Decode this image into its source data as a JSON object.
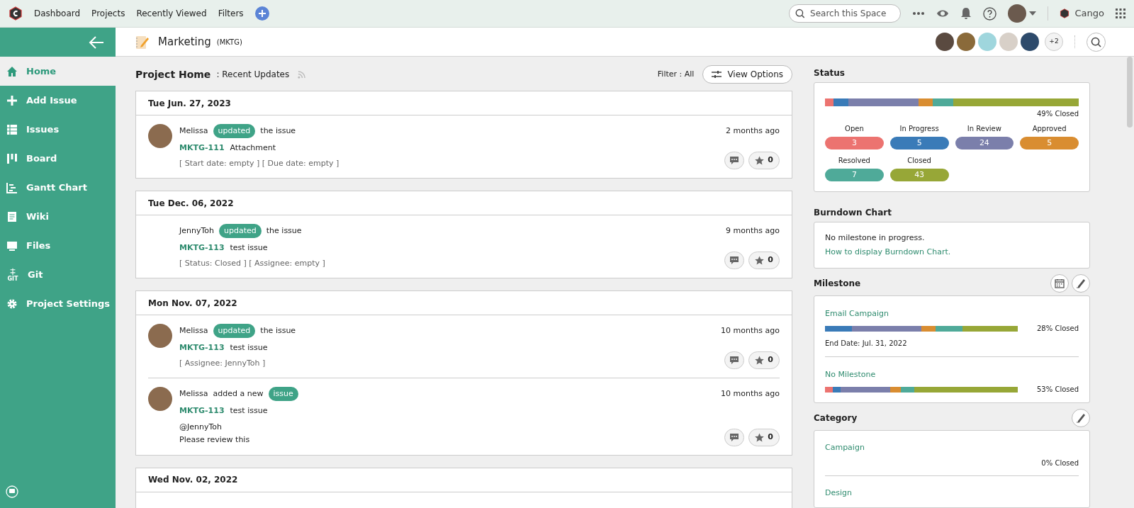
{
  "top_nav": {
    "items": [
      "Dashboard",
      "Projects",
      "Recently Viewed",
      "Filters"
    ],
    "search_placeholder": "Search this Space",
    "org": "Cango"
  },
  "project": {
    "name": "Marketing",
    "key": "(MKTG)",
    "members_more": "+2"
  },
  "sidebar": {
    "items": [
      {
        "label": "Home",
        "selected": true
      },
      {
        "label": "Add Issue",
        "selected": false
      },
      {
        "label": "Issues",
        "selected": false
      },
      {
        "label": "Board",
        "selected": false
      },
      {
        "label": "Gantt Chart",
        "selected": false
      },
      {
        "label": "Wiki",
        "selected": false
      },
      {
        "label": "Files",
        "selected": false
      },
      {
        "label": "Git",
        "icon_caption": "GIT",
        "selected": false
      },
      {
        "label": "Project Settings",
        "selected": false
      }
    ]
  },
  "feed": {
    "title": "Project Home",
    "subtitle": ": Recent Updates",
    "filter": "Filter : All",
    "view_options": "View Options",
    "groups": [
      {
        "date": "Tue Jun. 27, 2023",
        "entries": [
          {
            "avatar": true,
            "user": "Melissa",
            "badge": "updated",
            "after": "the issue",
            "issue_key": "MKTG-111",
            "issue_title": "Attachment",
            "details": [
              "[ Start date: empty ] [ Due date: empty ]"
            ],
            "time": "2 months ago",
            "stars": "0"
          }
        ]
      },
      {
        "date": "Tue Dec. 06, 2022",
        "entries": [
          {
            "avatar": false,
            "user": "JennyToh",
            "badge": "updated",
            "after": "the issue",
            "issue_key": "MKTG-113",
            "issue_title": "test issue",
            "details": [
              "[ Status: Closed ] [ Assignee: empty ]"
            ],
            "time": "9 months ago",
            "stars": "0"
          }
        ]
      },
      {
        "date": "Mon Nov. 07, 2022",
        "entries": [
          {
            "avatar": true,
            "user": "Melissa",
            "badge": "updated",
            "after": "the issue",
            "issue_key": "MKTG-113",
            "issue_title": "test issue",
            "details": [
              "[ Assignee: JennyToh ]"
            ],
            "time": "10 months ago",
            "stars": "0"
          },
          {
            "avatar": true,
            "user": "Melissa",
            "before": "added a new",
            "badge": "issue",
            "issue_key": "MKTG-113",
            "issue_title": "test issue",
            "comment": [
              "@JennyToh",
              "Please review this"
            ],
            "time": "10 months ago",
            "stars": "0"
          }
        ]
      },
      {
        "date": "Wed Nov. 02, 2022"
      }
    ]
  },
  "status": {
    "title": "Status",
    "closed_label": "49% Closed",
    "items": [
      {
        "label": "Open",
        "count": "3",
        "color": "#ec7370"
      },
      {
        "label": "In Progress",
        "count": "5",
        "color": "#3a7bb8"
      },
      {
        "label": "In Review",
        "count": "24",
        "color": "#7b7fab"
      },
      {
        "label": "Approved",
        "count": "5",
        "color": "#d98d31"
      },
      {
        "label": "Resolved",
        "count": "7",
        "color": "#4faa99"
      },
      {
        "label": "Closed",
        "count": "43",
        "color": "#97a737"
      }
    ]
  },
  "burndown": {
    "title": "Burndown Chart",
    "message": "No milestone in progress.",
    "link": "How to display Burndown Chart."
  },
  "milestone": {
    "title": "Milestone",
    "items": [
      {
        "name": "Email Campaign",
        "closed_label": "28% Closed",
        "end_date": "End Date: Jul. 31, 2022"
      },
      {
        "name": "No Milestone",
        "closed_label": "53% Closed"
      }
    ]
  },
  "category": {
    "title": "Category",
    "items": [
      {
        "name": "Campaign",
        "closed_label": "0% Closed"
      },
      {
        "name": "Design"
      }
    ]
  }
}
